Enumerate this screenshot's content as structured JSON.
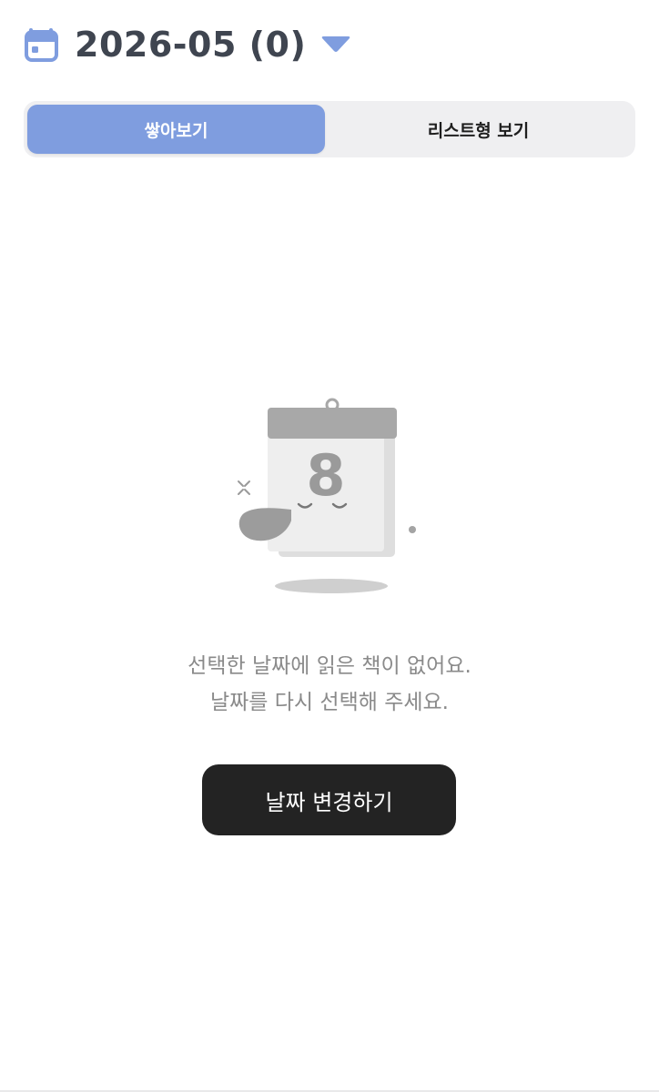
{
  "header": {
    "month_label": "2026-05 (0)",
    "calendar_icon": "calendar-icon",
    "dropdown_icon": "caret-down-icon"
  },
  "view_toggle": {
    "stack_label": "쌓아보기",
    "list_label": "리스트형 보기",
    "selected": "stack"
  },
  "empty_state": {
    "illustration": "sleeping-calendar-illustration",
    "calendar_digit": "8",
    "message_line1": "선택한 날짜에 읽은 책이 없어요.",
    "message_line2": "날짜를 다시 선택해 주세요.",
    "button_label": "날짜 변경하기"
  },
  "colors": {
    "accent": "#7f9ddf",
    "title_text": "#3f4550",
    "segment_background": "#efeff1",
    "message_text": "#8a8a8a",
    "button_background": "#232323",
    "button_text": "#ffffff"
  }
}
